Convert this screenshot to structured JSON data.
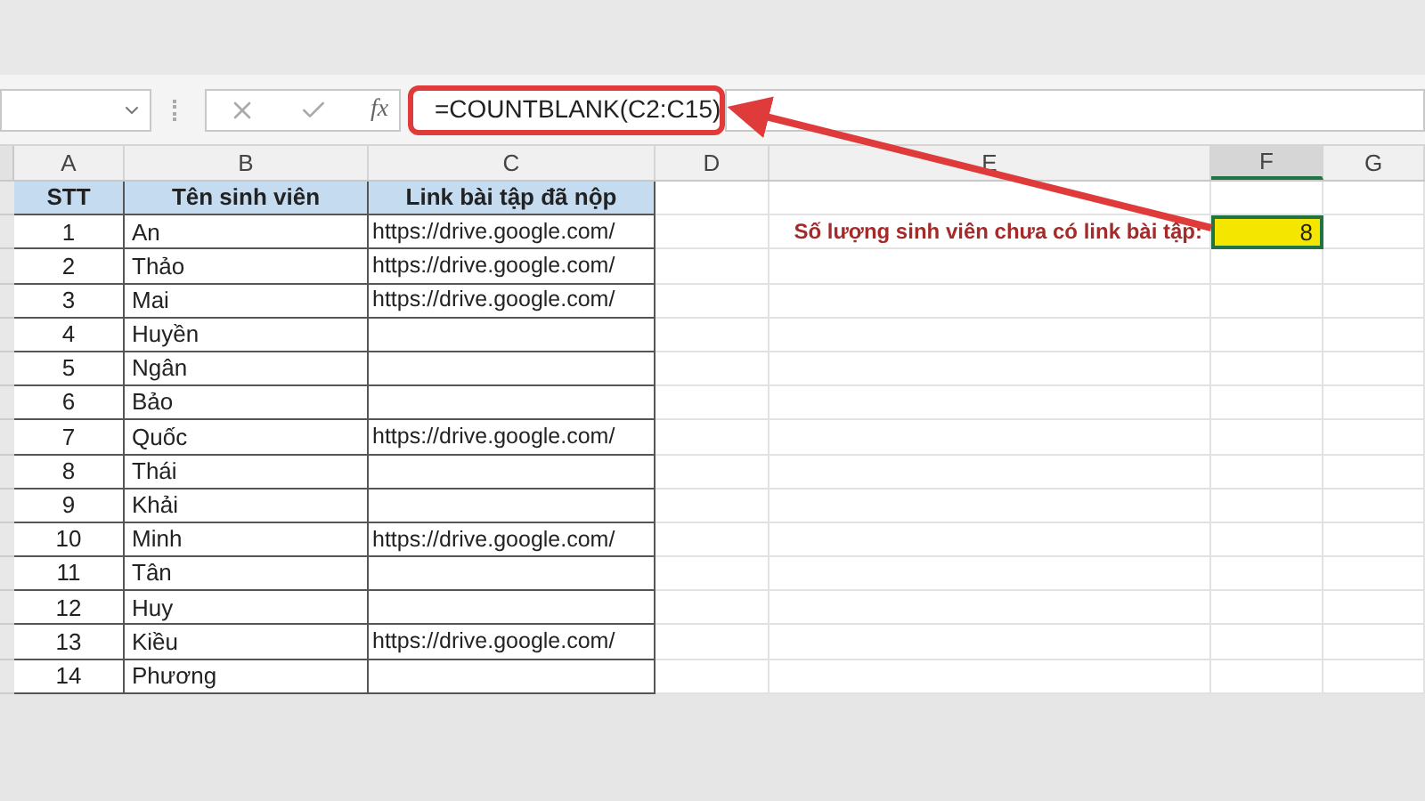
{
  "formula_bar": {
    "fx_label": "fx",
    "formula": "=COUNTBLANK(C2:C15)",
    "highlighted": true
  },
  "columns": [
    {
      "letter": "A",
      "selected": false
    },
    {
      "letter": "B",
      "selected": false
    },
    {
      "letter": "C",
      "selected": false
    },
    {
      "letter": "D",
      "selected": false
    },
    {
      "letter": "E",
      "selected": false
    },
    {
      "letter": "F",
      "selected": true
    },
    {
      "letter": "G",
      "selected": false
    }
  ],
  "header_row": [
    "STT",
    "Tên sinh viên",
    "Link bài tập đã nộp"
  ],
  "rows": [
    {
      "stt": "1",
      "name": "An",
      "link": "https://drive.google.com/"
    },
    {
      "stt": "2",
      "name": "Thảo",
      "link": "https://drive.google.com/"
    },
    {
      "stt": "3",
      "name": "Mai",
      "link": "https://drive.google.com/"
    },
    {
      "stt": "4",
      "name": "Huyền"
    },
    {
      "stt": "5",
      "name": "Ngân"
    },
    {
      "stt": "6",
      "name": "Bảo"
    },
    {
      "stt": "7",
      "name": "Quốc",
      "link": "https://drive.google.com/"
    },
    {
      "stt": "8",
      "name": "Thái"
    },
    {
      "stt": "9",
      "name": "Khải"
    },
    {
      "stt": "10",
      "name": "Minh",
      "link": "https://drive.google.com/"
    },
    {
      "stt": "11",
      "name": "Tân"
    },
    {
      "stt": "12",
      "name": "Huy"
    },
    {
      "stt": "13",
      "name": "Kiều",
      "link": "https://drive.google.com/"
    },
    {
      "stt": "14",
      "name": "Phương"
    }
  ],
  "result": {
    "label": "Số lượng sinh viên chưa có link bài tập:",
    "value": "8",
    "selected": true
  }
}
